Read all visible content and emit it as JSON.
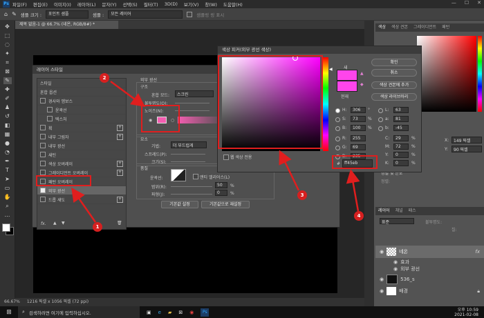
{
  "menu": {
    "logo": "Ps",
    "items": [
      "파일(F)",
      "편집(E)",
      "이미지(I)",
      "레이어(L)",
      "문자(Y)",
      "선택(S)",
      "필터(T)",
      "3D(D)",
      "보기(V)",
      "창(W)",
      "도움말(H)"
    ]
  },
  "options": {
    "sample_size_label": "샘플 크기 :",
    "sample_size_value": "포인트 샘플",
    "sample_label": "샘플 :",
    "sample_value": "모든 레이어",
    "show_ring_label": "샘플링 링 표시"
  },
  "document": {
    "tab_title": "제목 없음-1 @ 66.7% (네온, RGB/8#) *",
    "zoom": "66.67%",
    "size_info": "1216 픽셀 x 1056 픽셀 (72 ppi)"
  },
  "layer_style": {
    "title": "레이어 스타일",
    "list": [
      {
        "label": "스타일",
        "checkbox": false,
        "indent": false,
        "plus": false
      },
      {
        "label": "혼합 옵션",
        "checkbox": false,
        "indent": false,
        "plus": false
      },
      {
        "label": "경사와 엠보스",
        "checkbox": true,
        "checked": false,
        "indent": false,
        "plus": false
      },
      {
        "label": "윤곽선",
        "checkbox": true,
        "checked": false,
        "indent": true,
        "plus": false
      },
      {
        "label": "텍스처",
        "checkbox": true,
        "checked": false,
        "indent": true,
        "plus": false
      },
      {
        "label": "획",
        "checkbox": true,
        "checked": false,
        "indent": false,
        "plus": true
      },
      {
        "label": "내부 그림자",
        "checkbox": true,
        "checked": false,
        "indent": false,
        "plus": true
      },
      {
        "label": "내부 광선",
        "checkbox": true,
        "checked": false,
        "indent": false,
        "plus": false
      },
      {
        "label": "새틴",
        "checkbox": true,
        "checked": false,
        "indent": false,
        "plus": false
      },
      {
        "label": "색상 오버레이",
        "checkbox": true,
        "checked": false,
        "indent": false,
        "plus": true
      },
      {
        "label": "그레이디언트 오버레이",
        "checkbox": true,
        "checked": false,
        "indent": false,
        "plus": true
      },
      {
        "label": "패턴 오버레이",
        "checkbox": true,
        "checked": false,
        "indent": false,
        "plus": false
      },
      {
        "label": "외부 광선",
        "checkbox": true,
        "checked": true,
        "indent": false,
        "plus": false
      },
      {
        "label": "드롭 섀도",
        "checkbox": true,
        "checked": false,
        "indent": false,
        "plus": true
      }
    ],
    "fx_label": "fx.",
    "outer_glow_title": "외부 광선",
    "structure_label": "구조",
    "blend_mode_label": "혼합 모드:",
    "blend_mode_value": "스크린",
    "opacity_label": "불투명도(O):",
    "noise_label": "노이즈(N):",
    "elements_label": "요소",
    "technique_label": "기법:",
    "technique_value": "더 부드럽게",
    "spread_label": "스프레드(P):",
    "size_label": "크기(S):",
    "quality_label": "품질",
    "contour_label": "윤곽선:",
    "anti_alias_label": "앤티 앨리어스(L)",
    "range_label": "범위(R):",
    "range_value": "50",
    "jitter_label": "파형(J):",
    "jitter_value": "0",
    "percent": "%",
    "default_button": "기본값 설정",
    "reset_button": "기본값으로 재설정",
    "glow_color": "#f45eb1"
  },
  "color_picker": {
    "title": "색상 피커(외부 광선 색상)",
    "new_label": "새",
    "current_label": "현재",
    "ok_button": "확인",
    "cancel_button": "취소",
    "add_swatch_button": "색상 견본에 추가",
    "libraries_button": "색상 라이브러리",
    "web_only_label": "웹 색상 전용",
    "new_color": "#ff45eb",
    "current_color": "#ff45eb",
    "hsb": [
      {
        "label": "H:",
        "value": "306",
        "unit": "°"
      },
      {
        "label": "S:",
        "value": "73",
        "unit": "%"
      },
      {
        "label": "B:",
        "value": "100",
        "unit": "%"
      }
    ],
    "rgb": [
      {
        "label": "R:",
        "value": "255"
      },
      {
        "label": "G:",
        "value": "69"
      },
      {
        "label": "B:",
        "value": "235"
      }
    ],
    "lab": [
      {
        "label": "L:",
        "value": "63"
      },
      {
        "label": "a:",
        "value": "81"
      },
      {
        "label": "b:",
        "value": "-45"
      }
    ],
    "cmyk": [
      {
        "label": "C:",
        "value": "29",
        "unit": "%"
      },
      {
        "label": "M:",
        "value": "72",
        "unit": "%"
      },
      {
        "label": "Y:",
        "value": "0",
        "unit": "%"
      },
      {
        "label": "K:",
        "value": "0",
        "unit": "%"
      }
    ],
    "hex_label": "#",
    "hex_value": "ff45eb"
  },
  "right_panel": {
    "color_tabs": [
      "색상",
      "색상 견본",
      "그레이디언트",
      "패턴"
    ],
    "layers_tabs": [
      "레이어",
      "채널",
      "패스"
    ],
    "blend_value": "표준",
    "opacity_label": "불투명도:",
    "fill_label": "칠:",
    "x_label": "X:",
    "x_value": "149 픽셀",
    "y_label": "Y:",
    "y_value": "90 픽셀",
    "align_label": "정렬 및 분포",
    "align_sub": "정렬:",
    "layers": [
      {
        "name": "네온",
        "fx": "fx"
      },
      {
        "name": "효과",
        "fx": ""
      },
      {
        "name": "외부 광선",
        "fx": ""
      },
      {
        "name": "536_s",
        "fx": ""
      },
      {
        "name": "배경",
        "fx": ""
      }
    ]
  },
  "taskbar": {
    "search_placeholder": "검색하려면 여기에 입력하십시오.",
    "time": "오후 10:59",
    "date": "2021-02-08"
  },
  "annotations": [
    "1",
    "2",
    "3",
    "4"
  ]
}
